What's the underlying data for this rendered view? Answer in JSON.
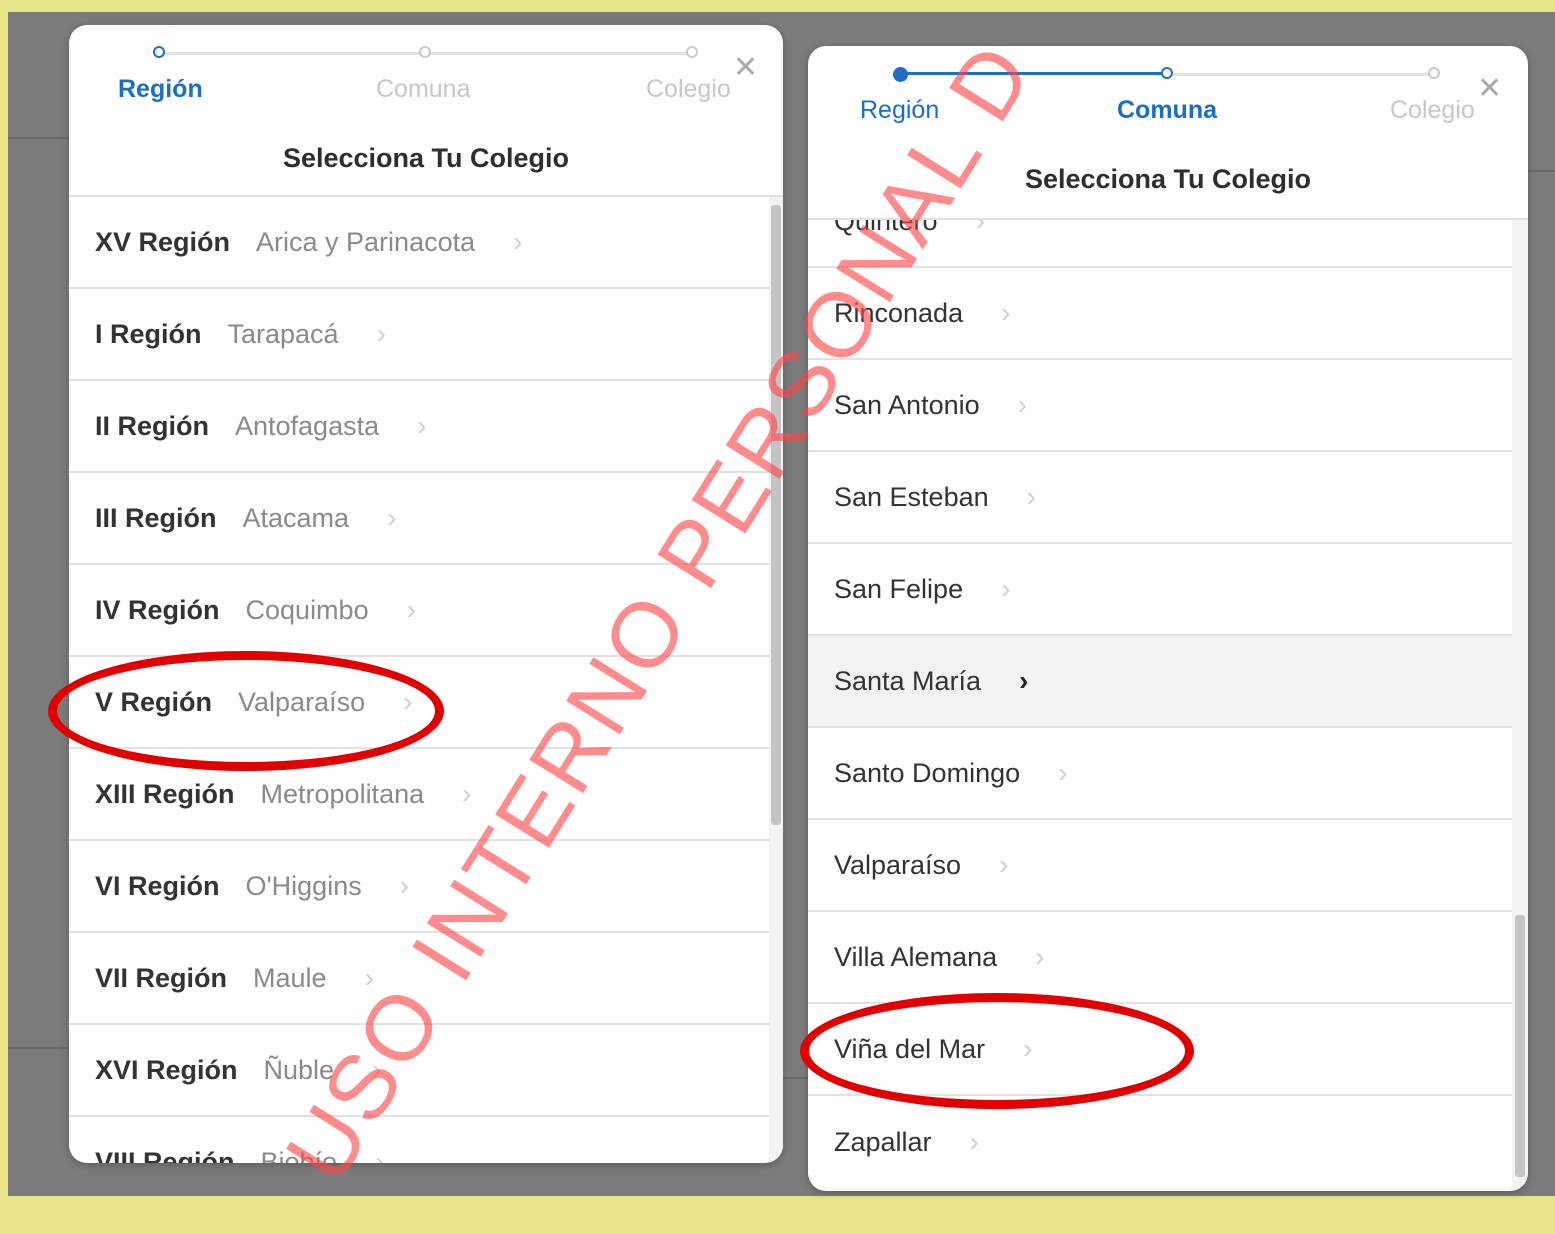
{
  "left_modal": {
    "steps": [
      {
        "label": "Región",
        "state": "current"
      },
      {
        "label": "Comuna",
        "state": "pending"
      },
      {
        "label": "Colegio",
        "state": "pending"
      }
    ],
    "close_glyph": "✕",
    "title": "Selecciona Tu Colegio",
    "regions": [
      {
        "code": "XV Región",
        "name": "Arica y Parinacota"
      },
      {
        "code": "I Región",
        "name": "Tarapacá"
      },
      {
        "code": "II Región",
        "name": "Antofagasta"
      },
      {
        "code": "III Región",
        "name": "Atacama"
      },
      {
        "code": "IV Región",
        "name": "Coquimbo"
      },
      {
        "code": "V Región",
        "name": "Valparaíso"
      },
      {
        "code": "XIII Región",
        "name": "Metropolitana"
      },
      {
        "code": "VI Región",
        "name": "O'Higgins"
      },
      {
        "code": "VII Región",
        "name": "Maule"
      },
      {
        "code": "XVI Región",
        "name": "Ñuble"
      },
      {
        "code": "VIII Región",
        "name": "Biobío"
      }
    ]
  },
  "right_modal": {
    "steps": [
      {
        "label": "Región",
        "state": "done"
      },
      {
        "label": "Comuna",
        "state": "current"
      },
      {
        "label": "Colegio",
        "state": "pending"
      }
    ],
    "close_glyph": "✕",
    "title": "Selecciona Tu Colegio",
    "comunas": [
      {
        "name": "Quintero"
      },
      {
        "name": "Rinconada"
      },
      {
        "name": "San Antonio"
      },
      {
        "name": "San Esteban"
      },
      {
        "name": "San Felipe"
      },
      {
        "name": "Santa María",
        "hovered": true
      },
      {
        "name": "Santo Domingo"
      },
      {
        "name": "Valparaíso"
      },
      {
        "name": "Villa Alemana"
      },
      {
        "name": "Viña del Mar"
      },
      {
        "name": "Zapallar"
      }
    ]
  },
  "chevron_glyph": "›",
  "annotations": {
    "highlighted_region": "V Región Valparaíso",
    "highlighted_comuna": "Viña del Mar",
    "color": "#e00000"
  },
  "watermark": "USO INTERNO PERSONAL D",
  "colors": {
    "accent": "#1a6fc4",
    "frame": "#e8e48a",
    "backdrop": "#7b7b7b"
  }
}
